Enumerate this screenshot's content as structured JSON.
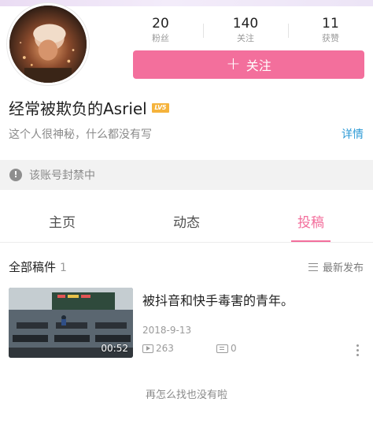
{
  "profile": {
    "name": "经常被欺负的Asriel",
    "level_badge": "LV5",
    "bio": "这个人很神秘，什么都没有写",
    "details_label": "详情",
    "stats": [
      {
        "value": "20",
        "label": "粉丝"
      },
      {
        "value": "140",
        "label": "关注"
      },
      {
        "value": "11",
        "label": "获赞"
      }
    ],
    "follow_label": "关注",
    "follow_icon": "plus-icon"
  },
  "notice": {
    "text": "该账号封禁中",
    "icon": "warning-icon"
  },
  "tabs": [
    {
      "label": "主页",
      "active": false
    },
    {
      "label": "动态",
      "active": false
    },
    {
      "label": "投稿",
      "active": true
    }
  ],
  "submissions": {
    "title": "全部稿件",
    "count": "1",
    "sort_label": "最新发布",
    "items": [
      {
        "title": "被抖音和快手毒害的青年。",
        "date": "2018-9-13",
        "duration": "00:52",
        "views": "263",
        "comments": "0"
      }
    ],
    "end_hint": "再怎么找也没有啦"
  },
  "colors": {
    "accent_pink": "#f36f9c",
    "link_blue": "#2d9ad6",
    "level_badge": "#f5b33c"
  }
}
